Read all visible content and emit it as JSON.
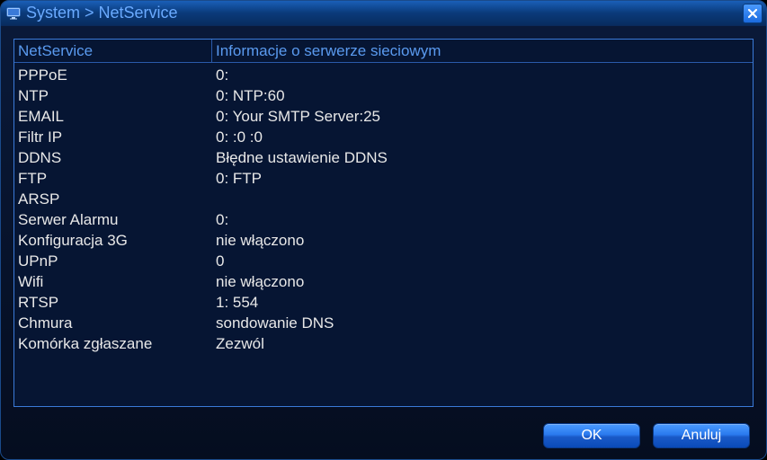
{
  "titlebar": {
    "path": "System > NetService"
  },
  "table": {
    "header_name": "NetService",
    "header_info": "Informacje o serwerze sieciowym",
    "rows": [
      {
        "name": "PPPoE",
        "info": "0:"
      },
      {
        "name": "NTP",
        "info": "0: NTP:60"
      },
      {
        "name": "EMAIL",
        "info": "0: Your SMTP Server:25"
      },
      {
        "name": "Filtr IP",
        "info": "0: :0 :0"
      },
      {
        "name": "DDNS",
        "info": "Błędne ustawienie DDNS"
      },
      {
        "name": "FTP",
        "info": "0: FTP"
      },
      {
        "name": "ARSP",
        "info": ""
      },
      {
        "name": "Serwer Alarmu",
        "info": "0:"
      },
      {
        "name": "Konfiguracja 3G",
        "info": "nie włączono"
      },
      {
        "name": "UPnP",
        "info": "0"
      },
      {
        "name": "Wifi",
        "info": "nie włączono"
      },
      {
        "name": "RTSP",
        "info": "1: 554"
      },
      {
        "name": "Chmura",
        "info": "sondowanie DNS"
      },
      {
        "name": "Komórka zgłaszane",
        "info": "Zezwól"
      }
    ]
  },
  "buttons": {
    "ok": "OK",
    "cancel": "Anuluj"
  }
}
